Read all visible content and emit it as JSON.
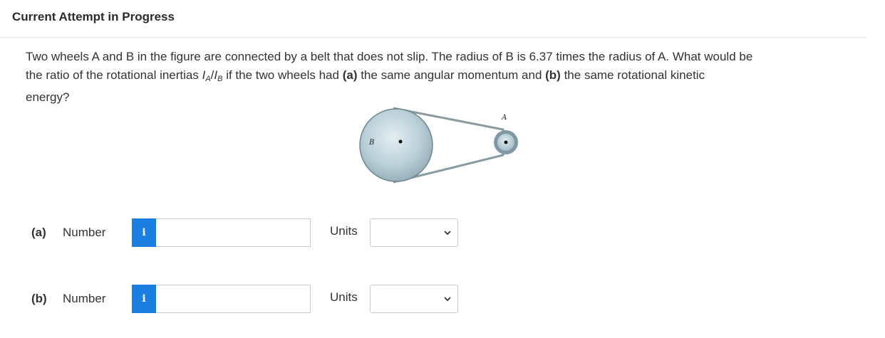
{
  "header": {
    "title": "Current Attempt in Progress"
  },
  "question": {
    "line1": "Two wheels A and B in the figure are connected by a belt that does not slip. The radius of B is 6.37 times the radius of A. What would be",
    "line2_pre": "the ratio of the rotational inertias ",
    "inertia_I1": "I",
    "inertia_sub_A": "A",
    "slash": "/",
    "inertia_I2": "I",
    "inertia_sub_B": "B",
    "line2_mid": " if the two wheels had ",
    "part_a_marker": "(a)",
    "line2_mid2": " the same angular momentum and ",
    "part_b_marker": "(b)",
    "line2_post": " the same rotational kinetic",
    "line3": "energy?"
  },
  "figure": {
    "label_B": "B",
    "label_A": "A"
  },
  "answers": [
    {
      "part": "(a)",
      "number_label": "Number",
      "info_icon": "i",
      "value": "",
      "units_label": "Units",
      "units_selected": ""
    },
    {
      "part": "(b)",
      "number_label": "Number",
      "info_icon": "i",
      "value": "",
      "units_label": "Units",
      "units_selected": ""
    }
  ],
  "colors": {
    "info_button": "#1a7fe0",
    "wheel": "#b9cfd8",
    "belt": "#8a9aa1"
  }
}
